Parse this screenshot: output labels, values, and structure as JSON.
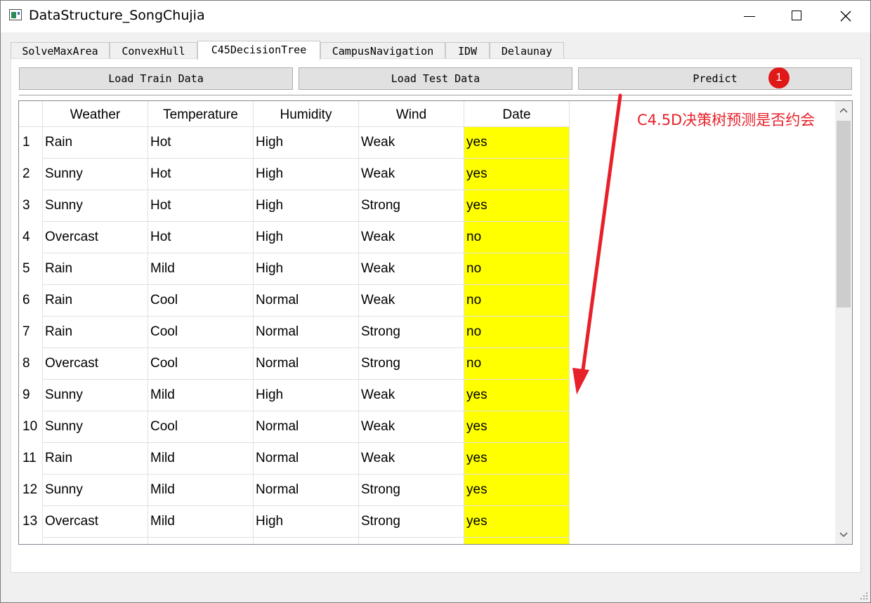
{
  "window": {
    "title": "DataStructure_SongChujia",
    "controls": {
      "minimize": "minimize-icon",
      "maximize": "maximize-icon",
      "close": "close-icon"
    }
  },
  "tabs": [
    {
      "label": "SolveMaxArea"
    },
    {
      "label": "ConvexHull"
    },
    {
      "label": "C45DecisionTree",
      "active": true
    },
    {
      "label": "CampusNavigation"
    },
    {
      "label": "IDW"
    },
    {
      "label": "Delaunay"
    }
  ],
  "toolbar": {
    "load_train": "Load Train Data",
    "load_test": "Load Test Data",
    "predict": "Predict"
  },
  "table": {
    "columns": [
      "Weather",
      "Temperature",
      "Humidity",
      "Wind",
      "Date"
    ],
    "rows": [
      {
        "n": "1",
        "cells": [
          "Rain",
          "Hot",
          "High",
          "Weak",
          "yes"
        ]
      },
      {
        "n": "2",
        "cells": [
          "Sunny",
          "Hot",
          "High",
          "Weak",
          "yes"
        ]
      },
      {
        "n": "3",
        "cells": [
          "Sunny",
          "Hot",
          "High",
          "Strong",
          "yes"
        ]
      },
      {
        "n": "4",
        "cells": [
          "Overcast",
          "Hot",
          "High",
          "Weak",
          "no"
        ]
      },
      {
        "n": "5",
        "cells": [
          "Rain",
          "Mild",
          "High",
          "Weak",
          "no"
        ]
      },
      {
        "n": "6",
        "cells": [
          "Rain",
          "Cool",
          "Normal",
          "Weak",
          "no"
        ]
      },
      {
        "n": "7",
        "cells": [
          "Rain",
          "Cool",
          "Normal",
          "Strong",
          "no"
        ]
      },
      {
        "n": "8",
        "cells": [
          "Overcast",
          "Cool",
          "Normal",
          "Strong",
          "no"
        ]
      },
      {
        "n": "9",
        "cells": [
          "Sunny",
          "Mild",
          "High",
          "Weak",
          "yes"
        ]
      },
      {
        "n": "10",
        "cells": [
          "Sunny",
          "Cool",
          "Normal",
          "Weak",
          "yes"
        ]
      },
      {
        "n": "11",
        "cells": [
          "Rain",
          "Mild",
          "Normal",
          "Weak",
          "yes"
        ]
      },
      {
        "n": "12",
        "cells": [
          "Sunny",
          "Mild",
          "Normal",
          "Strong",
          "yes"
        ]
      },
      {
        "n": "13",
        "cells": [
          "Overcast",
          "Mild",
          "High",
          "Strong",
          "yes"
        ]
      },
      {
        "n": "",
        "cells": [
          "",
          "",
          "",
          "",
          ""
        ]
      }
    ],
    "highlight_color": "#ffff00"
  },
  "annotation": {
    "text": "C4.5D决策树预测是否约会",
    "badge": "1",
    "color": "#e8202a"
  },
  "scrollbar": {
    "up_icon": "chevron-up-icon",
    "down_icon": "chevron-down-icon"
  }
}
